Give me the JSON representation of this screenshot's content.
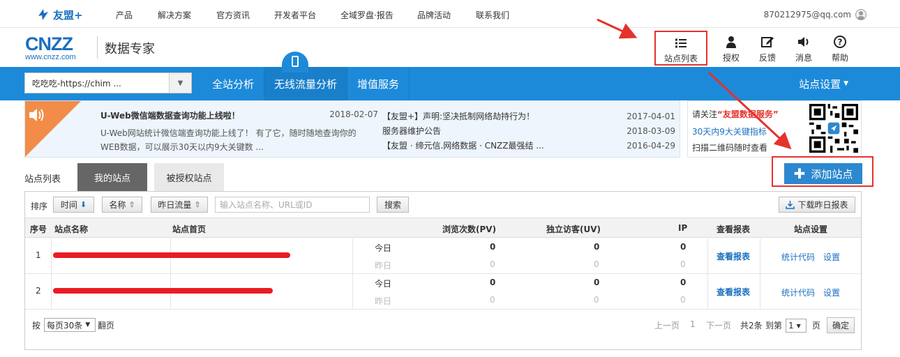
{
  "topbar": {
    "brand": "友盟+",
    "nav": [
      "产品",
      "解决方案",
      "官方资讯",
      "开发者平台",
      "全域罗盘·报告",
      "品牌活动",
      "联系我们"
    ],
    "user_email": "870212975@qq.com"
  },
  "header": {
    "logo_main": "CNZZ",
    "logo_sub": "www.cnzz.com",
    "product_name": "数据专家",
    "icons": [
      {
        "label": "站点列表",
        "icon": "list-icon"
      },
      {
        "label": "授权",
        "icon": "user-icon"
      },
      {
        "label": "反馈",
        "icon": "edit-icon"
      },
      {
        "label": "消息",
        "icon": "speaker-icon"
      },
      {
        "label": "帮助",
        "icon": "help-icon"
      }
    ]
  },
  "bluebar": {
    "site_select_value": "吃吃吃-https://chim ...",
    "nav": [
      "全站分析",
      "无线流量分析",
      "增值服务"
    ],
    "settings": "站点设置"
  },
  "notice": {
    "main_title": "U-Web微信端数据查询功能上线啦！",
    "main_date": "2018-02-07",
    "main_desc_1": "U-Web网站统计微信端查询功能上线了！ 有了它，随时随地查询你的",
    "main_desc_2": "WEB数据，可以展示30天以内9大关键数 ...",
    "items": [
      {
        "text": "【友盟+】声明:坚决抵制网络劫持行为！",
        "date": "2017-04-01"
      },
      {
        "text": "服务器维护公告",
        "date": "2018-03-09"
      },
      {
        "text": "【友盟 · 缔元信.网络数据 · CNZZ最强结 ...",
        "date": "2016-04-29"
      }
    ]
  },
  "follow": {
    "prefix": "请关注",
    "highlight": "“友盟数据服务”",
    "line2": "30天内9大关键指标",
    "line3": "扫描二维码随时查看"
  },
  "tabs": {
    "label": "站点列表",
    "mine": "我的站点",
    "authorized": "被授权站点",
    "add_site": "添加站点"
  },
  "toolbar": {
    "sort_label": "排序",
    "sort_time": "时间",
    "sort_name": "名称",
    "sort_traffic": "昨日流量",
    "search_placeholder": "输入站点名称、URL或ID",
    "search_button": "搜索",
    "download": "下载昨日报表"
  },
  "table": {
    "headers": [
      "序号",
      "站点名称",
      "站点首页",
      "浏览次数(PV)",
      "独立访客(UV)",
      "IP",
      "查看报表",
      "站点设置"
    ],
    "rows": [
      {
        "index": "1",
        "today_label": "今日",
        "yesterday_label": "昨日",
        "pv_today": "0",
        "pv_yesterday": "0",
        "uv_today": "0",
        "uv_yesterday": "0",
        "ip_today": "0",
        "ip_yesterday": "0",
        "report": "查看报表",
        "code": "统计代码",
        "settings": "设置"
      },
      {
        "index": "2",
        "today_label": "今日",
        "yesterday_label": "昨日",
        "pv_today": "0",
        "pv_yesterday": "0",
        "uv_today": "0",
        "uv_yesterday": "0",
        "ip_today": "0",
        "ip_yesterday": "0",
        "report": "查看报表",
        "code": "统计代码",
        "settings": "设置"
      }
    ]
  },
  "pager": {
    "per_prefix": "按",
    "per_value": "每页30条",
    "per_suffix": "翻页",
    "prev": "上一页",
    "current": "1",
    "next": "下一页",
    "total": "共2条",
    "goto_prefix": "到第",
    "goto_value": "1",
    "goto_suffix": "页",
    "confirm": "确定"
  },
  "colors": {
    "brand_blue": "#1d8ad9",
    "annotation_red": "#e5322d",
    "notice_orange": "#f28c48"
  }
}
